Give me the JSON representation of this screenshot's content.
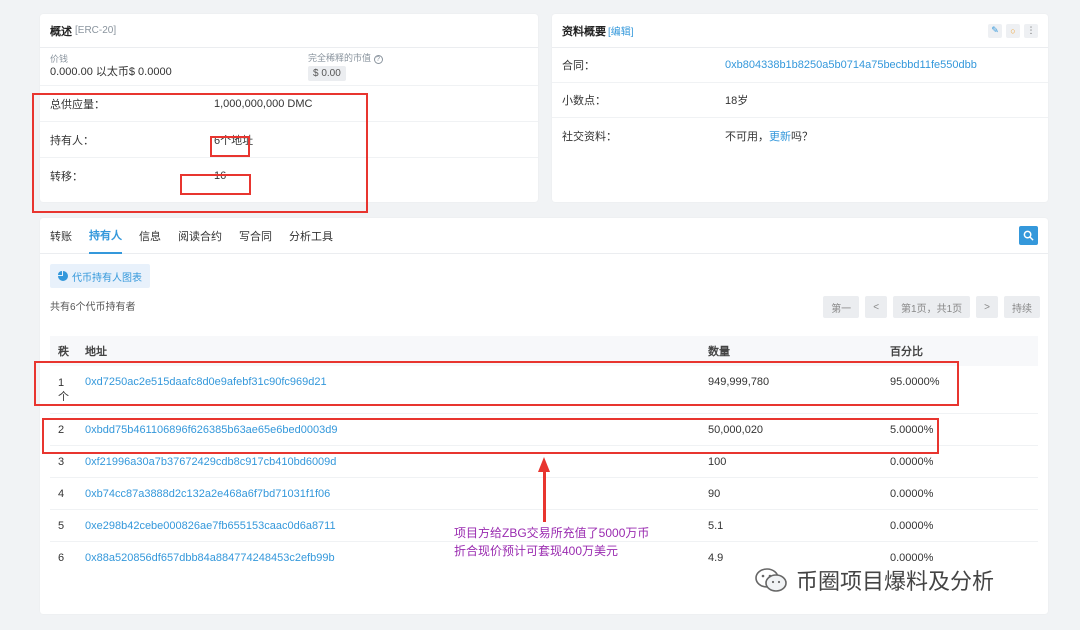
{
  "overview": {
    "title": "概述",
    "token_type": "[ERC-20]",
    "price_label": "价钱",
    "price_value": "0.000.00 以太币$ 0.0000",
    "mcap_label": "完全稀释的市值",
    "mcap_help_icon": "question-circle-icon",
    "mcap_value": "$ 0.00",
    "total_supply_label": "总供应量：",
    "total_supply_value": "1,000,000,000 DMC",
    "holders_label": "持有人：",
    "holders_value": "6个地址",
    "transfers_label": "转移：",
    "transfers_value": "16"
  },
  "profile": {
    "title": "资料概要",
    "edit_label": "[编辑]",
    "contract_label": "合同：",
    "contract_value": "0xb804338b1b8250a5b0714a75becbbd11fe550dbb",
    "decimals_label": "小数点：",
    "decimals_value": "18岁",
    "social_label": "社交资料：",
    "social_prefix": "不可用，",
    "social_link": "更新",
    "social_suffix": "吗？",
    "icons": [
      "wand-icon",
      "circle-icon",
      "more-vertical-icon"
    ]
  },
  "tabs": [
    {
      "label": "转账",
      "active": false
    },
    {
      "label": "持有人",
      "active": true
    },
    {
      "label": "信息",
      "active": false
    },
    {
      "label": "阅读合约",
      "active": false
    },
    {
      "label": "写合同",
      "active": false
    },
    {
      "label": "分析工具",
      "active": false
    }
  ],
  "holders": {
    "chart_button": "代币持有人图表",
    "count_text": "共有6个代币持有者",
    "pager": {
      "first": "第一",
      "prev": "<",
      "page_info": "第1页，共1页",
      "next": ">",
      "last": "持续"
    },
    "columns": {
      "rank": "秩",
      "address": "地址",
      "quantity": "数量",
      "percent": "百分比"
    },
    "rows": [
      {
        "rank": "1",
        "rank_sub": "个",
        "address": "0xd7250ac2e515daafc8d0e9afebf31c90fc969d21",
        "quantity": "949,999,780",
        "percent": "95.0000%"
      },
      {
        "rank": "2",
        "address": "0xbdd75b461106896f626385b63ae65e6bed0003d9",
        "quantity": "50,000,020",
        "percent": "5.0000%"
      },
      {
        "rank": "3",
        "address": "0xf21996a30a7b37672429cdb8c917cb410bd6009d",
        "quantity": "100",
        "percent": "0.0000%"
      },
      {
        "rank": "4",
        "address": "0xb74cc87a3888d2c132a2e468a6f7bd71031f1f06",
        "quantity": "90",
        "percent": "0.0000%"
      },
      {
        "rank": "5",
        "address": "0xe298b42cebe000826ae7fb655153caac0d6a8711",
        "quantity": "5.1",
        "percent": "0.0000%"
      },
      {
        "rank": "6",
        "address": "0x88a520856df657dbb84a884774248453c2efb99b",
        "quantity": "4.9",
        "percent": "0.0000%"
      }
    ]
  },
  "annotation": {
    "line1": "项目方给ZBG交易所充值了5000万币",
    "line2": "折合现价预计可套现400万美元"
  },
  "watermark": {
    "text": "币圈项目爆料及分析",
    "icon": "wechat-icon"
  },
  "colors": {
    "accent": "#3498db",
    "highlight": "#e8352f",
    "annotation": "#9a2bb0"
  }
}
